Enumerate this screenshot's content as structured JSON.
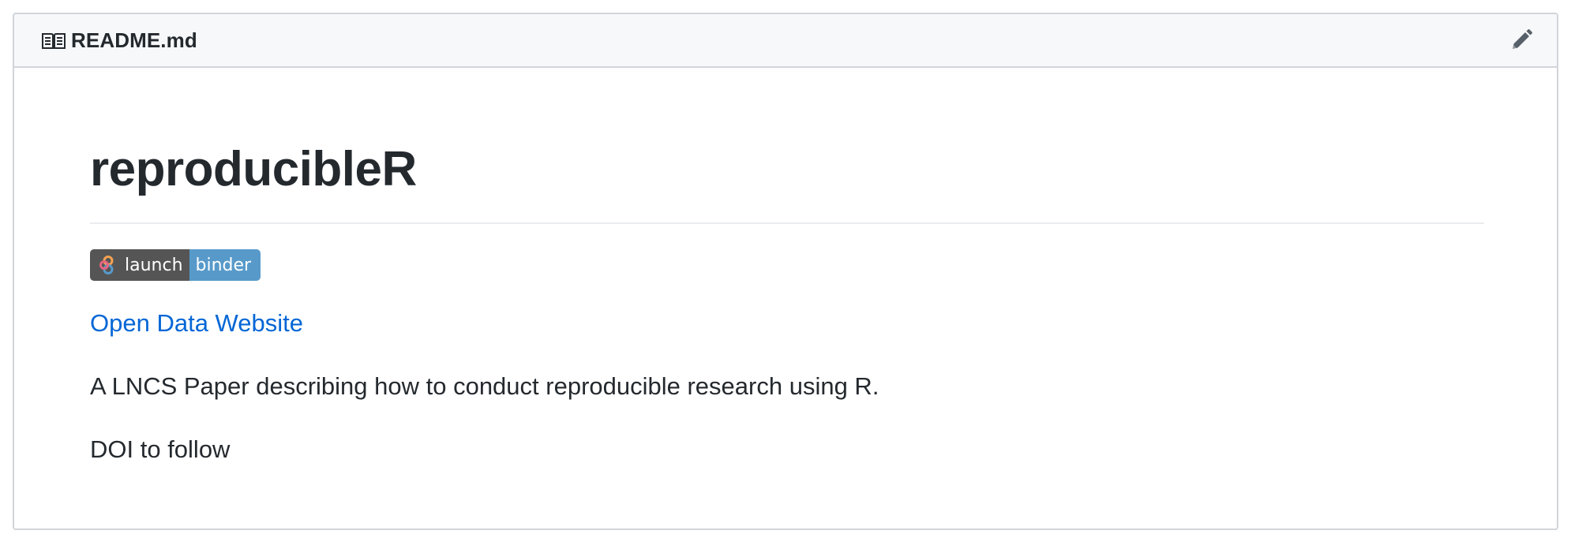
{
  "readme": {
    "header": {
      "filename": "README.md",
      "book_icon": "book-icon",
      "edit_icon": "pencil-icon"
    },
    "title": "reproducibleR",
    "badge": {
      "left_label": "launch",
      "right_label": "binder",
      "logo_icon": "binder-logo-icon",
      "colors": {
        "left": "#555555",
        "right": "#579aca"
      }
    },
    "link_text": "Open Data Website",
    "description": "A LNCS Paper describing how to conduct reproducible research using R.",
    "doi_note": "DOI to follow"
  },
  "colors": {
    "link": "#0366d6",
    "text": "#24292e",
    "header_bg": "#f6f8fa",
    "border": "#d1d5da"
  }
}
